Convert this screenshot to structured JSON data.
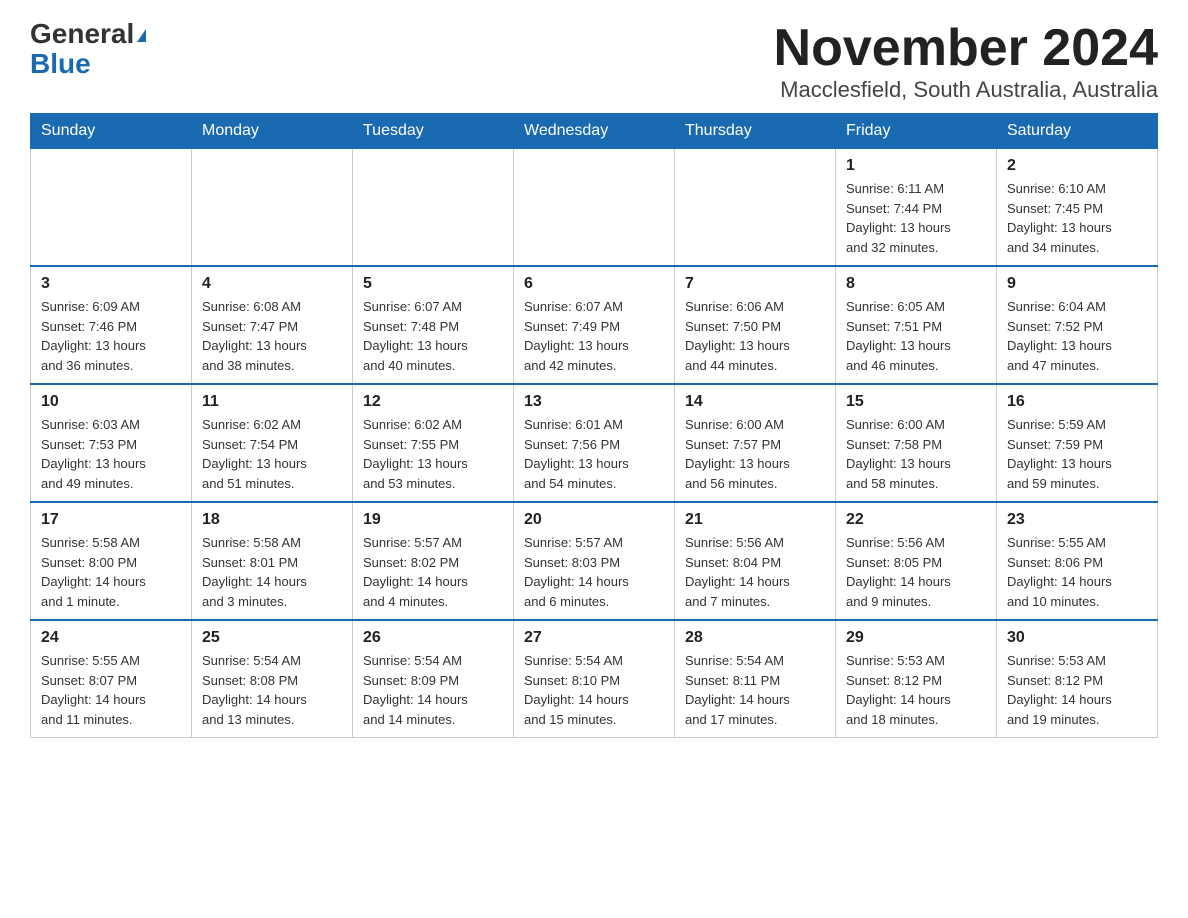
{
  "header": {
    "logo_general": "General",
    "logo_blue": "Blue",
    "month_title": "November 2024",
    "location": "Macclesfield, South Australia, Australia"
  },
  "weekdays": [
    "Sunday",
    "Monday",
    "Tuesday",
    "Wednesday",
    "Thursday",
    "Friday",
    "Saturday"
  ],
  "weeks": [
    [
      {
        "day": "",
        "info": ""
      },
      {
        "day": "",
        "info": ""
      },
      {
        "day": "",
        "info": ""
      },
      {
        "day": "",
        "info": ""
      },
      {
        "day": "",
        "info": ""
      },
      {
        "day": "1",
        "info": "Sunrise: 6:11 AM\nSunset: 7:44 PM\nDaylight: 13 hours\nand 32 minutes."
      },
      {
        "day": "2",
        "info": "Sunrise: 6:10 AM\nSunset: 7:45 PM\nDaylight: 13 hours\nand 34 minutes."
      }
    ],
    [
      {
        "day": "3",
        "info": "Sunrise: 6:09 AM\nSunset: 7:46 PM\nDaylight: 13 hours\nand 36 minutes."
      },
      {
        "day": "4",
        "info": "Sunrise: 6:08 AM\nSunset: 7:47 PM\nDaylight: 13 hours\nand 38 minutes."
      },
      {
        "day": "5",
        "info": "Sunrise: 6:07 AM\nSunset: 7:48 PM\nDaylight: 13 hours\nand 40 minutes."
      },
      {
        "day": "6",
        "info": "Sunrise: 6:07 AM\nSunset: 7:49 PM\nDaylight: 13 hours\nand 42 minutes."
      },
      {
        "day": "7",
        "info": "Sunrise: 6:06 AM\nSunset: 7:50 PM\nDaylight: 13 hours\nand 44 minutes."
      },
      {
        "day": "8",
        "info": "Sunrise: 6:05 AM\nSunset: 7:51 PM\nDaylight: 13 hours\nand 46 minutes."
      },
      {
        "day": "9",
        "info": "Sunrise: 6:04 AM\nSunset: 7:52 PM\nDaylight: 13 hours\nand 47 minutes."
      }
    ],
    [
      {
        "day": "10",
        "info": "Sunrise: 6:03 AM\nSunset: 7:53 PM\nDaylight: 13 hours\nand 49 minutes."
      },
      {
        "day": "11",
        "info": "Sunrise: 6:02 AM\nSunset: 7:54 PM\nDaylight: 13 hours\nand 51 minutes."
      },
      {
        "day": "12",
        "info": "Sunrise: 6:02 AM\nSunset: 7:55 PM\nDaylight: 13 hours\nand 53 minutes."
      },
      {
        "day": "13",
        "info": "Sunrise: 6:01 AM\nSunset: 7:56 PM\nDaylight: 13 hours\nand 54 minutes."
      },
      {
        "day": "14",
        "info": "Sunrise: 6:00 AM\nSunset: 7:57 PM\nDaylight: 13 hours\nand 56 minutes."
      },
      {
        "day": "15",
        "info": "Sunrise: 6:00 AM\nSunset: 7:58 PM\nDaylight: 13 hours\nand 58 minutes."
      },
      {
        "day": "16",
        "info": "Sunrise: 5:59 AM\nSunset: 7:59 PM\nDaylight: 13 hours\nand 59 minutes."
      }
    ],
    [
      {
        "day": "17",
        "info": "Sunrise: 5:58 AM\nSunset: 8:00 PM\nDaylight: 14 hours\nand 1 minute."
      },
      {
        "day": "18",
        "info": "Sunrise: 5:58 AM\nSunset: 8:01 PM\nDaylight: 14 hours\nand 3 minutes."
      },
      {
        "day": "19",
        "info": "Sunrise: 5:57 AM\nSunset: 8:02 PM\nDaylight: 14 hours\nand 4 minutes."
      },
      {
        "day": "20",
        "info": "Sunrise: 5:57 AM\nSunset: 8:03 PM\nDaylight: 14 hours\nand 6 minutes."
      },
      {
        "day": "21",
        "info": "Sunrise: 5:56 AM\nSunset: 8:04 PM\nDaylight: 14 hours\nand 7 minutes."
      },
      {
        "day": "22",
        "info": "Sunrise: 5:56 AM\nSunset: 8:05 PM\nDaylight: 14 hours\nand 9 minutes."
      },
      {
        "day": "23",
        "info": "Sunrise: 5:55 AM\nSunset: 8:06 PM\nDaylight: 14 hours\nand 10 minutes."
      }
    ],
    [
      {
        "day": "24",
        "info": "Sunrise: 5:55 AM\nSunset: 8:07 PM\nDaylight: 14 hours\nand 11 minutes."
      },
      {
        "day": "25",
        "info": "Sunrise: 5:54 AM\nSunset: 8:08 PM\nDaylight: 14 hours\nand 13 minutes."
      },
      {
        "day": "26",
        "info": "Sunrise: 5:54 AM\nSunset: 8:09 PM\nDaylight: 14 hours\nand 14 minutes."
      },
      {
        "day": "27",
        "info": "Sunrise: 5:54 AM\nSunset: 8:10 PM\nDaylight: 14 hours\nand 15 minutes."
      },
      {
        "day": "28",
        "info": "Sunrise: 5:54 AM\nSunset: 8:11 PM\nDaylight: 14 hours\nand 17 minutes."
      },
      {
        "day": "29",
        "info": "Sunrise: 5:53 AM\nSunset: 8:12 PM\nDaylight: 14 hours\nand 18 minutes."
      },
      {
        "day": "30",
        "info": "Sunrise: 5:53 AM\nSunset: 8:12 PM\nDaylight: 14 hours\nand 19 minutes."
      }
    ]
  ]
}
